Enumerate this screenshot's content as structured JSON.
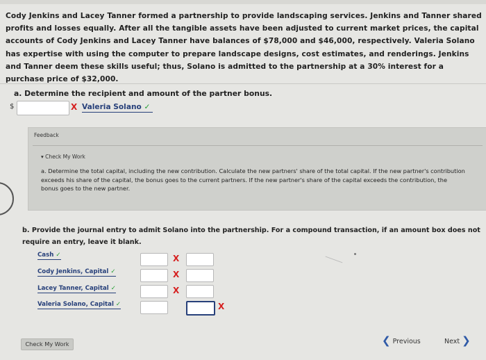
{
  "problem_text": "Cody Jenkins and Lacey Tanner formed a partnership to provide landscaping services. Jenkins and Tanner shared profits and losses equally. After all the tangible assets have been adjusted to current market prices, the capital accounts of Cody Jenkins and Lacey Tanner have balances of $78,000 and $46,000, respectively. Valeria Solano has expertise with using the computer to prepare landscape designs, cost estimates, and renderings. Jenkins and Tanner deem these skills useful; thus, Solano is admitted to the partnership at a 30% interest for a purchase price of $32,000.",
  "part_a": {
    "label": "a.",
    "question": "Determine the recipient and amount of the partner bonus.",
    "currency": "$",
    "amount_value": "",
    "wrong_mark": "X",
    "recipient": "Valeria Solano",
    "correct_mark": "✓"
  },
  "feedback": {
    "title": "Feedback",
    "check_my_work": "▾ Check My Work",
    "text": "a. Determine the total capital, including the new contribution. Calculate the new partners' share of the total capital. If the new partner's contribution exceeds his share of the capital, the bonus goes to the current partners. If the new partner's share of the capital exceeds the contribution, the bonus goes to the new partner."
  },
  "part_b": {
    "label": "b.",
    "question": "Provide the journal entry to admit Solano into the partnership. For a compound transaction, if an amount box does not require an entry, leave it blank.",
    "accounts": [
      {
        "name": "Cash",
        "mark": "✓",
        "debit_wrong": "X",
        "debit": "",
        "credit": ""
      },
      {
        "name": "Cody Jenkins, Capital",
        "mark": "✓",
        "debit_wrong": "X",
        "debit": "",
        "credit": ""
      },
      {
        "name": "Lacey Tanner, Capital",
        "mark": "✓",
        "debit_wrong": "X",
        "debit": "",
        "credit": ""
      },
      {
        "name": "Valeria Solano, Capital",
        "mark": "✓",
        "credit_wrong": "X",
        "debit": "",
        "credit": ""
      }
    ]
  },
  "footer": {
    "check_my_work_button": "Check My Work",
    "previous": "Previous",
    "next": "Next"
  },
  "icons": {
    "prev": "chevron-left-icon",
    "next": "chevron-right-icon"
  },
  "colors": {
    "wrong": "#d62020",
    "correct": "#1d9a2c",
    "link": "#27407a",
    "nav_chevron": "#2f5aa7"
  }
}
